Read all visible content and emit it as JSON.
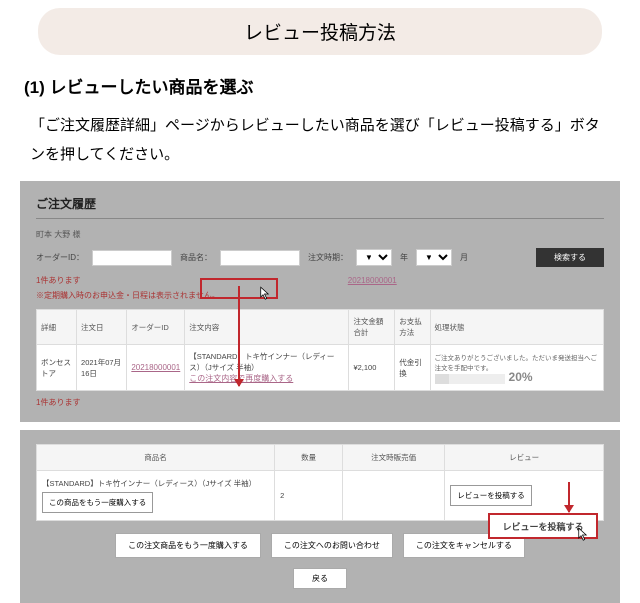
{
  "title": "レビュー投稿方法",
  "step": {
    "heading": "(1) レビューしたい商品を選ぶ",
    "desc": "「ご注文履歴詳細」ページからレビューしたい商品を選び「レビュー投稿する」ボタンを押してください。"
  },
  "shot1": {
    "title": "ご注文履歴",
    "customer": "町本 大野 様",
    "labels": {
      "orderId": "オーダーID：",
      "product": "商品名：",
      "period": "注文時期：",
      "year": "年",
      "month": "月"
    },
    "search": "検索する",
    "count": "1件あります",
    "note": "※定期購入時のお申込金・日程は表示されません。",
    "orderLink": "20218000001",
    "table": {
      "h": [
        "詳細",
        "注文日",
        "オーダーID",
        "注文内容",
        "注文金額合計",
        "お支払方法",
        "処理状態"
      ],
      "r": {
        "c0": "ボンセストア",
        "c1": "2021年07月16日",
        "c2": "20218000001",
        "c3a": "【STANDARD】トキ竹インナー（レディース）（Jサイズ 半袖）",
        "c3b": "この注文内容で再度購入する",
        "c4": "¥2,100",
        "c5": "代金引換",
        "c6": "ご注文ありがとうございました。ただいま発送担当へご注文を手配中です。",
        "pct": "20%"
      }
    }
  },
  "shot2": {
    "table": {
      "h": [
        "商品名",
        "数量",
        "注文時販売価",
        "レビュー"
      ],
      "r": {
        "name": "【STANDARD】トキ竹インナー（レディース）（Jサイズ 半袖）",
        "btn1": "この商品をもう一度購入する",
        "qty": "2",
        "rev": "レビューを投稿する"
      }
    },
    "actions": [
      "この注文商品をもう一度購入する",
      "この注文へのお問い合わせ",
      "この注文をキャンセルする"
    ],
    "back": "戻る",
    "callout": "レビューを投稿する"
  }
}
